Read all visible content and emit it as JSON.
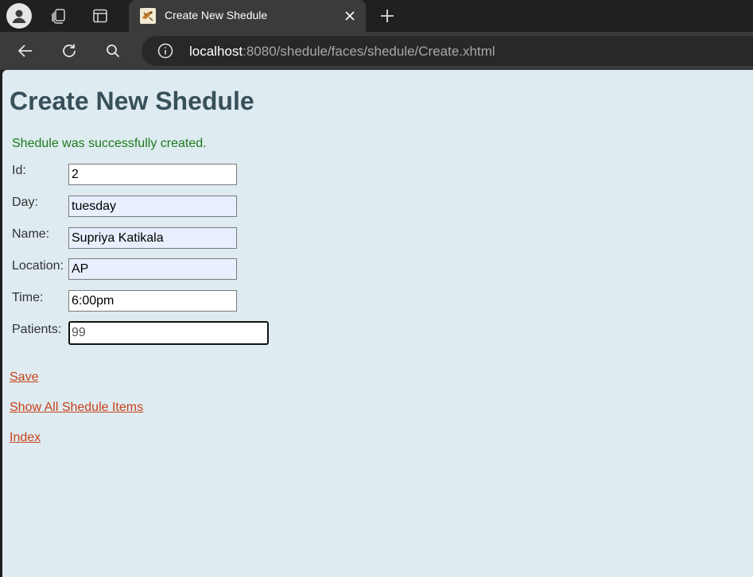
{
  "browser": {
    "tab": {
      "title": "Create New Shedule"
    },
    "address": {
      "host": "localhost",
      "path": ":8080/shedule/faces/shedule/Create.xhtml"
    }
  },
  "page": {
    "title": "Create New Shedule",
    "success_message": "Shedule was successfully created.",
    "fields": [
      {
        "label": "Id:",
        "value": "2"
      },
      {
        "label": "Day:",
        "value": "tuesday"
      },
      {
        "label": "Name:",
        "value": "Supriya Katikala"
      },
      {
        "label": "Location:",
        "value": "AP"
      },
      {
        "label": "Time:",
        "value": "6:00pm"
      },
      {
        "label": "Patients:",
        "value": "99"
      }
    ],
    "links": {
      "save": "Save",
      "show_all": "Show All Shedule Items",
      "index": "Index"
    }
  },
  "colors": {
    "page_background": "#deebf0",
    "title": "#37505a",
    "success": "#1c7a1c",
    "link": "#c8431b",
    "autofill": "#e8f0fe"
  }
}
